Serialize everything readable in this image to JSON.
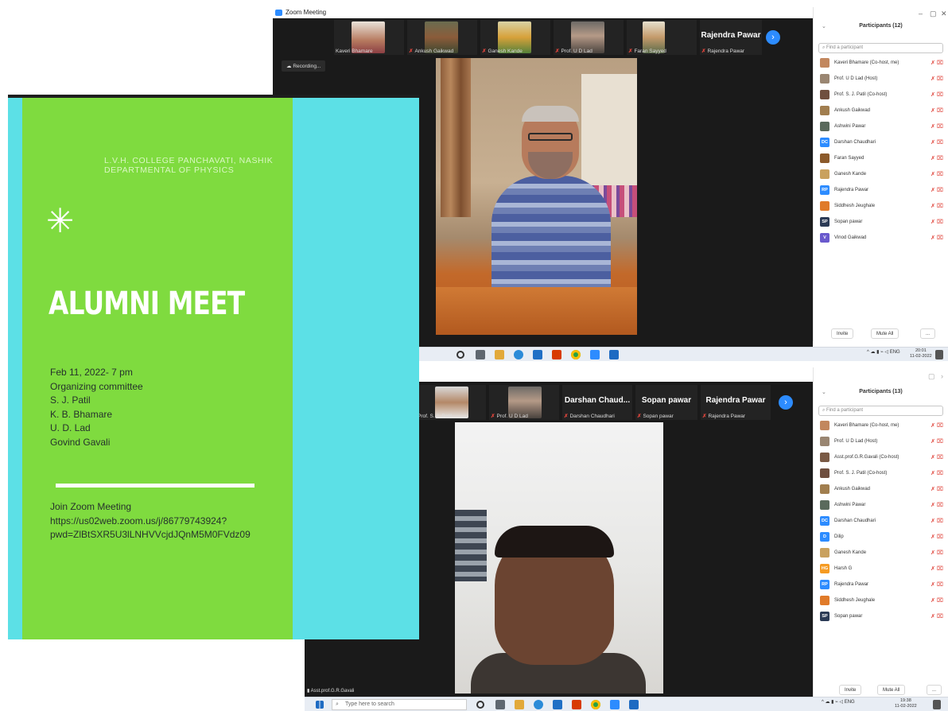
{
  "poster": {
    "college": "L.V.H. COLLEGE PANCHAVATI, NASHIK",
    "department": "DEPARTMENTAL OF PHYSICS",
    "title": "ALUMNI MEET",
    "date": "Feb 11, 2022- 7 pm",
    "committee_heading": "Organizing committee",
    "committee": [
      "S. J. Patil",
      "K. B. Bhamare",
      "U. D. Lad",
      "Govind Gavali"
    ],
    "join_label": "Join Zoom Meeting",
    "link_line1": "https://us02web.zoom.us/j/86779743924?",
    "link_line2": "pwd=ZlBtSXR5U3lLNHVVcjdJQnM5M0FVdz09",
    "colors": {
      "cyan": "#5ce0e6",
      "green": "#7fdb3f"
    }
  },
  "window1": {
    "title": "Zoom Meeting",
    "recording": "Recording...",
    "gallery": [
      "Kaveri Bhamare",
      "Ankush Gaikwad",
      "Ganesh Kande",
      "Prof. U D Lad",
      "Faran Sayyed",
      "Rajendra Pawar"
    ],
    "gallery_big": [
      "Rajendra Pawar"
    ],
    "participants_title": "Participants (12)",
    "search_placeholder": "Find a participant",
    "participants": [
      {
        "name": "Kaveri Bhamare (Co-host, me)",
        "initials": "",
        "color": "#c2875e"
      },
      {
        "name": "Prof. U D Lad (Host)",
        "initials": "",
        "color": "#9a8672"
      },
      {
        "name": "Prof. S. J. Patil (Co-host)",
        "initials": "",
        "color": "#6f4f3f"
      },
      {
        "name": "Ankush Gaikwad",
        "initials": "",
        "color": "#a17e4f"
      },
      {
        "name": "Ashwini Pawar",
        "initials": "",
        "color": "#5a6a5c"
      },
      {
        "name": "Darshan Chaudhari",
        "initials": "DC",
        "color": "#2d8cff"
      },
      {
        "name": "Faran Sayyed",
        "initials": "",
        "color": "#8b5a2b"
      },
      {
        "name": "Ganesh Kande",
        "initials": "",
        "color": "#c9a15e"
      },
      {
        "name": "Rajendra Pawar",
        "initials": "RP",
        "color": "#2d8cff"
      },
      {
        "name": "Siddhesh Jeughale",
        "initials": "",
        "color": "#e07b2a"
      },
      {
        "name": "Sopan pawar",
        "initials": "SP",
        "color": "#2b3a55"
      },
      {
        "name": "Vinod Gaikwad",
        "initials": "V",
        "color": "#6a5acd"
      }
    ],
    "invite": "Invite",
    "mute_all": "Mute All",
    "more": "...",
    "tray_lang": "ENG",
    "time": "20:01",
    "date": "11-02-2022"
  },
  "window2": {
    "gallery": [
      "Prof. S. J. Patil",
      "Prof. U D Lad",
      "Darshan Chaudhari",
      "Sopan pawar",
      "Rajendra Pawar"
    ],
    "gallery_big": [
      "Darshan Chaud...",
      "Sopan pawar",
      "Rajendra Pawar"
    ],
    "participants_title": "Participants (13)",
    "search_placeholder": "Find a participant",
    "participants": [
      {
        "name": "Kaveri Bhamare (Co-host, me)",
        "initials": "",
        "color": "#c2875e"
      },
      {
        "name": "Prof. U D Lad (Host)",
        "initials": "",
        "color": "#9a8672"
      },
      {
        "name": "Asst.prof.G.R.Gavali (Co-host)",
        "initials": "",
        "color": "#7a5a45"
      },
      {
        "name": "Prof. S. J. Patil (Co-host)",
        "initials": "",
        "color": "#6f4f3f"
      },
      {
        "name": "Ankush Gaikwad",
        "initials": "",
        "color": "#a17e4f"
      },
      {
        "name": "Ashwini Pawar",
        "initials": "",
        "color": "#5a6a5c"
      },
      {
        "name": "Darshan Chaudhari",
        "initials": "DC",
        "color": "#2d8cff"
      },
      {
        "name": "Dilip",
        "initials": "D",
        "color": "#2d8cff"
      },
      {
        "name": "Ganesh Kande",
        "initials": "",
        "color": "#c9a15e"
      },
      {
        "name": "Harsh G",
        "initials": "HG",
        "color": "#f59b23"
      },
      {
        "name": "Rajendra Pawar",
        "initials": "RP",
        "color": "#2d8cff"
      },
      {
        "name": "Siddhesh Jeughale",
        "initials": "",
        "color": "#e07b2a"
      },
      {
        "name": "Sopan pawar",
        "initials": "SP",
        "color": "#2b3a55"
      }
    ],
    "speaker_label": "Asst.prof.G.R.Gavali",
    "invite": "Invite",
    "mute_all": "Mute All",
    "more": "...",
    "search_taskbar": "Type here to search",
    "tray_lang": "ENG",
    "time": "19:38",
    "date": "11-02-2022"
  }
}
